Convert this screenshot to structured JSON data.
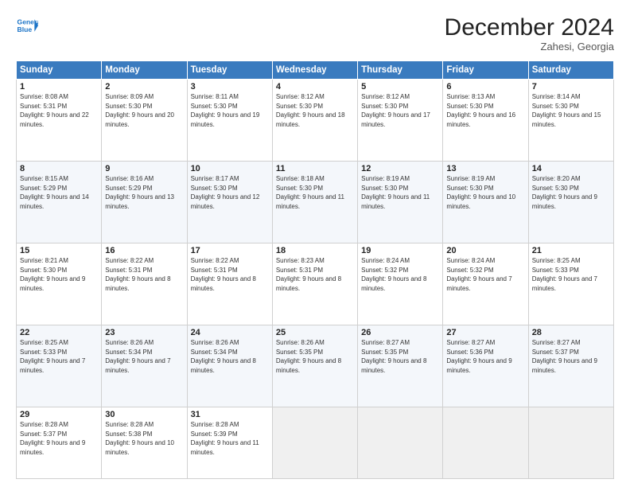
{
  "header": {
    "logo_line1": "General",
    "logo_line2": "Blue",
    "month": "December 2024",
    "location": "Zahesi, Georgia"
  },
  "weekdays": [
    "Sunday",
    "Monday",
    "Tuesday",
    "Wednesday",
    "Thursday",
    "Friday",
    "Saturday"
  ],
  "weeks": [
    [
      {
        "day": "1",
        "sunrise": "Sunrise: 8:08 AM",
        "sunset": "Sunset: 5:31 PM",
        "daylight": "Daylight: 9 hours and 22 minutes."
      },
      {
        "day": "2",
        "sunrise": "Sunrise: 8:09 AM",
        "sunset": "Sunset: 5:30 PM",
        "daylight": "Daylight: 9 hours and 20 minutes."
      },
      {
        "day": "3",
        "sunrise": "Sunrise: 8:11 AM",
        "sunset": "Sunset: 5:30 PM",
        "daylight": "Daylight: 9 hours and 19 minutes."
      },
      {
        "day": "4",
        "sunrise": "Sunrise: 8:12 AM",
        "sunset": "Sunset: 5:30 PM",
        "daylight": "Daylight: 9 hours and 18 minutes."
      },
      {
        "day": "5",
        "sunrise": "Sunrise: 8:12 AM",
        "sunset": "Sunset: 5:30 PM",
        "daylight": "Daylight: 9 hours and 17 minutes."
      },
      {
        "day": "6",
        "sunrise": "Sunrise: 8:13 AM",
        "sunset": "Sunset: 5:30 PM",
        "daylight": "Daylight: 9 hours and 16 minutes."
      },
      {
        "day": "7",
        "sunrise": "Sunrise: 8:14 AM",
        "sunset": "Sunset: 5:30 PM",
        "daylight": "Daylight: 9 hours and 15 minutes."
      }
    ],
    [
      {
        "day": "8",
        "sunrise": "Sunrise: 8:15 AM",
        "sunset": "Sunset: 5:29 PM",
        "daylight": "Daylight: 9 hours and 14 minutes."
      },
      {
        "day": "9",
        "sunrise": "Sunrise: 8:16 AM",
        "sunset": "Sunset: 5:29 PM",
        "daylight": "Daylight: 9 hours and 13 minutes."
      },
      {
        "day": "10",
        "sunrise": "Sunrise: 8:17 AM",
        "sunset": "Sunset: 5:30 PM",
        "daylight": "Daylight: 9 hours and 12 minutes."
      },
      {
        "day": "11",
        "sunrise": "Sunrise: 8:18 AM",
        "sunset": "Sunset: 5:30 PM",
        "daylight": "Daylight: 9 hours and 11 minutes."
      },
      {
        "day": "12",
        "sunrise": "Sunrise: 8:19 AM",
        "sunset": "Sunset: 5:30 PM",
        "daylight": "Daylight: 9 hours and 11 minutes."
      },
      {
        "day": "13",
        "sunrise": "Sunrise: 8:19 AM",
        "sunset": "Sunset: 5:30 PM",
        "daylight": "Daylight: 9 hours and 10 minutes."
      },
      {
        "day": "14",
        "sunrise": "Sunrise: 8:20 AM",
        "sunset": "Sunset: 5:30 PM",
        "daylight": "Daylight: 9 hours and 9 minutes."
      }
    ],
    [
      {
        "day": "15",
        "sunrise": "Sunrise: 8:21 AM",
        "sunset": "Sunset: 5:30 PM",
        "daylight": "Daylight: 9 hours and 9 minutes."
      },
      {
        "day": "16",
        "sunrise": "Sunrise: 8:22 AM",
        "sunset": "Sunset: 5:31 PM",
        "daylight": "Daylight: 9 hours and 8 minutes."
      },
      {
        "day": "17",
        "sunrise": "Sunrise: 8:22 AM",
        "sunset": "Sunset: 5:31 PM",
        "daylight": "Daylight: 9 hours and 8 minutes."
      },
      {
        "day": "18",
        "sunrise": "Sunrise: 8:23 AM",
        "sunset": "Sunset: 5:31 PM",
        "daylight": "Daylight: 9 hours and 8 minutes."
      },
      {
        "day": "19",
        "sunrise": "Sunrise: 8:24 AM",
        "sunset": "Sunset: 5:32 PM",
        "daylight": "Daylight: 9 hours and 8 minutes."
      },
      {
        "day": "20",
        "sunrise": "Sunrise: 8:24 AM",
        "sunset": "Sunset: 5:32 PM",
        "daylight": "Daylight: 9 hours and 7 minutes."
      },
      {
        "day": "21",
        "sunrise": "Sunrise: 8:25 AM",
        "sunset": "Sunset: 5:33 PM",
        "daylight": "Daylight: 9 hours and 7 minutes."
      }
    ],
    [
      {
        "day": "22",
        "sunrise": "Sunrise: 8:25 AM",
        "sunset": "Sunset: 5:33 PM",
        "daylight": "Daylight: 9 hours and 7 minutes."
      },
      {
        "day": "23",
        "sunrise": "Sunrise: 8:26 AM",
        "sunset": "Sunset: 5:34 PM",
        "daylight": "Daylight: 9 hours and 7 minutes."
      },
      {
        "day": "24",
        "sunrise": "Sunrise: 8:26 AM",
        "sunset": "Sunset: 5:34 PM",
        "daylight": "Daylight: 9 hours and 8 minutes."
      },
      {
        "day": "25",
        "sunrise": "Sunrise: 8:26 AM",
        "sunset": "Sunset: 5:35 PM",
        "daylight": "Daylight: 9 hours and 8 minutes."
      },
      {
        "day": "26",
        "sunrise": "Sunrise: 8:27 AM",
        "sunset": "Sunset: 5:35 PM",
        "daylight": "Daylight: 9 hours and 8 minutes."
      },
      {
        "day": "27",
        "sunrise": "Sunrise: 8:27 AM",
        "sunset": "Sunset: 5:36 PM",
        "daylight": "Daylight: 9 hours and 9 minutes."
      },
      {
        "day": "28",
        "sunrise": "Sunrise: 8:27 AM",
        "sunset": "Sunset: 5:37 PM",
        "daylight": "Daylight: 9 hours and 9 minutes."
      }
    ],
    [
      {
        "day": "29",
        "sunrise": "Sunrise: 8:28 AM",
        "sunset": "Sunset: 5:37 PM",
        "daylight": "Daylight: 9 hours and 9 minutes."
      },
      {
        "day": "30",
        "sunrise": "Sunrise: 8:28 AM",
        "sunset": "Sunset: 5:38 PM",
        "daylight": "Daylight: 9 hours and 10 minutes."
      },
      {
        "day": "31",
        "sunrise": "Sunrise: 8:28 AM",
        "sunset": "Sunset: 5:39 PM",
        "daylight": "Daylight: 9 hours and 11 minutes."
      },
      null,
      null,
      null,
      null
    ]
  ]
}
